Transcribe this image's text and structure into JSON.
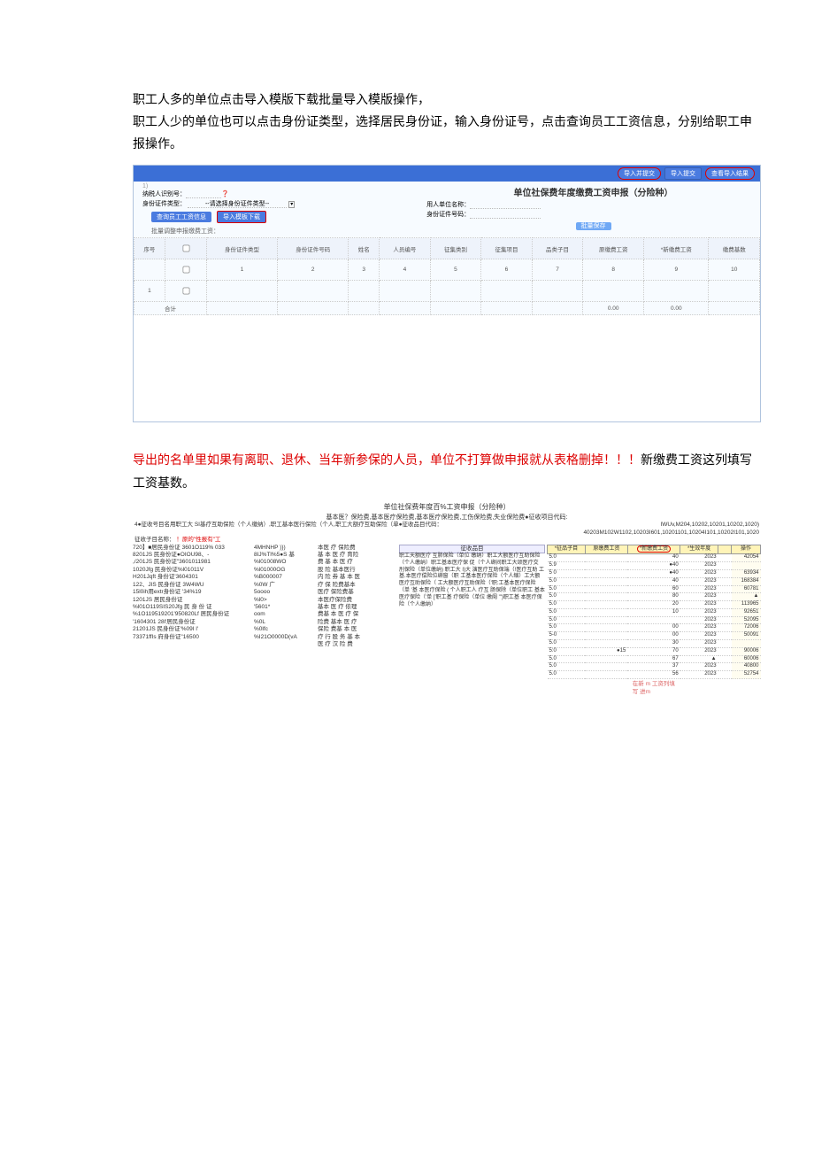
{
  "intro": {
    "line1": "职工人多的单位点击导入模版下载批量导入模版操作，",
    "line2": "职工人少的单位也可以点击身份证类型，选择居民身份证，输入身份证号，点击查询员工工资信息，分别给职工申报操作。"
  },
  "topbar": {
    "btn_import_submit": "导入并提交",
    "btn_import": "导入提交",
    "btn_view": "查看导入结果"
  },
  "form": {
    "title": "单位社保费年度缴费工资申报（分险种）",
    "left_label1": "纳税人识别号：",
    "left_label2": "身份证件类型：",
    "left_placeholder": "--请选择身份证件类型--",
    "right_label1": "用人单位名称：",
    "right_label2": "身份证件号码：",
    "btn_query": "查询员工工资信息",
    "btn_template": "导入模板下载",
    "sub_label": "批量调整申报缴费工资：",
    "btn_save": "批量保存"
  },
  "grid": {
    "headers": [
      "序号",
      "",
      "身份证件类型",
      "身份证件号码",
      "姓名",
      "人员编号",
      "征集类别",
      "征集项目",
      "品类子目",
      "原缴费工资",
      "*新缴费工资",
      "缴费基数"
    ],
    "row1": [
      "",
      "",
      "1",
      "",
      "2",
      "3",
      "4",
      "5",
      "6",
      "7",
      "8",
      "9",
      "10"
    ],
    "total_label": "合计",
    "total_v1": "0.00",
    "total_v2": "0.00"
  },
  "para2": {
    "red": "导出的名单里如果有离职、退休、当年新参保的人员，单位不打算做申报就从表格删掉！！！",
    "black": "新缴费工资这列填写工资基数。"
  },
  "report": {
    "title": "单位社保费年度百%工资申报（分险种）",
    "sub_line": "基本医？保险费,基本医疗保险费,基本医疗保险费,工伤保险费,失业保险费●征收项目代码:",
    "proj_line": "4●征收号目名用职工大 SI基疗互助保险（个人缴纳）,职工基本医行保险（个人,职工大额疗互助保险（单●征收品目代码：",
    "codes": "IWUv,M204,10202,10201,10202,1020)\n40203M102W1102,10203I601,10201101,10204I101,10202I101,1020",
    "hint_red": "！原的\"性报有\"工",
    "folder_label": "征收子目名称：",
    "footer_note": "在新 m 工资列填\n写 进m",
    "yellow_headers": [
      "*征品子目",
      "原缴费工资",
      "*新缴费工资",
      "*生效年度",
      "操作"
    ],
    "col1_lines": [
      "720】■居民身份证 3601O119% 033",
      "8201JS 民身份证●OIOU98、-",
      ",/201JS 民身份证\"3601011981",
      "1020Jfg 民身份证%l01011V",
      "H201Jqft 身份证'3604301",
      "122、JIS 民身份证 3W4WU",
      "15l0ih用extr身份证 '34%19",
      "1201JS 居民身份证",
      "%l01O119SIS20Jfg 民 身 份 证",
      "%1O119519201'950820Lf 居民身份证",
      "'1604301 28l'居民身份证",
      "21201JS 民身份证'%09I l'",
      "73371ffIs 府身份证\"16500"
    ],
    "col2_top": "4MHNHP          )})",
    "col2_lines": [
      "8IJ%Tl%5●S 基",
      "%l01008WO",
      "%l01000OG",
      "%B000007",
      "%0W     广",
      "5oooo",
      "%l0>",
      "'5601*",
      "",
      "oom",
      "",
      "%0L",
      "%0lfc",
      "%I21O0000D(vA"
    ],
    "col3_lines": [
      "本医 疗 保险费",
      "基 本 医 疗 育险",
      "费 基 本 医 疗",
      "股 险  基本医行",
      "内 险 券 基 本 医",
      "疗 保 险费基本",
      "医疗 保险费基",
      "本医疗保险费",
      "基本 医 疗 侬理",
      "费基 本 医 疗 保",
      "险费 基本 医 疗",
      "保险 费基 本 医",
      "疗 行 股 务 基 本",
      "医 疗 汉 险 费"
    ],
    "col4_header": "征收品目",
    "col4_lines": [
      "职工天额医疗 互肺保险（单位 缴纳）职工大额医疗互助保险（个人缴纳）职工基本医疗保 促（个人缬间职工大颂医疗交 刖保险（单位缴纳) 职工大 I)大 演医疗互助保端（!医疗互助 工基.本医疗偿险位缬窗（职 工基本医疗保险（个人缩）工大额医疗互助保险（ 工大额医疗互助保险（'职:工基本医疗保险（单 '基 本医疗保险 ( 个人职工人 疗互 肠保除（单位职工 基本医疗保险（'单 ['职工基 疗保险（单位 缴阍 '\")职工基 本医疗保险（个人缴纳）"
    ],
    "data_rows": [
      {
        "c1": "5.0",
        "c2": "",
        "c3": "40",
        "c4": "2023",
        "amt": "42054"
      },
      {
        "c1": "5.9",
        "c2": "",
        "c3": "●40",
        "c4": "2023",
        "amt": ""
      },
      {
        "c1": "5 0",
        "c2": "",
        "c3": "●40",
        "c4": "2023",
        "amt": "63934"
      },
      {
        "c1": "5.0",
        "c2": "",
        "c3": "40",
        "c4": "2023",
        "amt": "168384"
      },
      {
        "c1": "5.0",
        "c2": "",
        "c3": "60",
        "c4": "2023",
        "amt": "60781"
      },
      {
        "c1": "5.0",
        "c2": "",
        "c3": "80",
        "c4": "2023",
        "amt": "▲"
      },
      {
        "c1": "5.0",
        "c2": "",
        "c3": "20",
        "c4": "2023",
        "amt": "113965"
      },
      {
        "c1": "5.0",
        "c2": "",
        "c3": "10",
        "c4": "2023",
        "amt": "92651"
      },
      {
        "c1": "5.0",
        "c2": "",
        "c3": "",
        "c4": "2023",
        "amt": "52095"
      },
      {
        "c1": "5.0",
        "c2": "",
        "c3": "00",
        "c4": "2023",
        "amt": "72006"
      },
      {
        "c1": "5-0",
        "c2": "",
        "c3": "00",
        "c4": "2023",
        "amt": "50091"
      },
      {
        "c1": "5.0",
        "c2": "",
        "c3": "30",
        "c4": "2023",
        "amt": ""
      },
      {
        "c1": "5:0",
        "c2": "●15",
        "c3": "70",
        "c4": "2023",
        "amt": "90006"
      },
      {
        "c1": "5.0",
        "c2": "",
        "c3": "67",
        "c4": "▲",
        "amt": "60006"
      },
      {
        "c1": "5.0",
        "c2": "",
        "c3": "37",
        "c4": "2023",
        "amt": "40800"
      },
      {
        "c1": "5.0",
        "c2": "",
        "c3": "56",
        "c4": "2023",
        "amt": "52754"
      }
    ]
  }
}
